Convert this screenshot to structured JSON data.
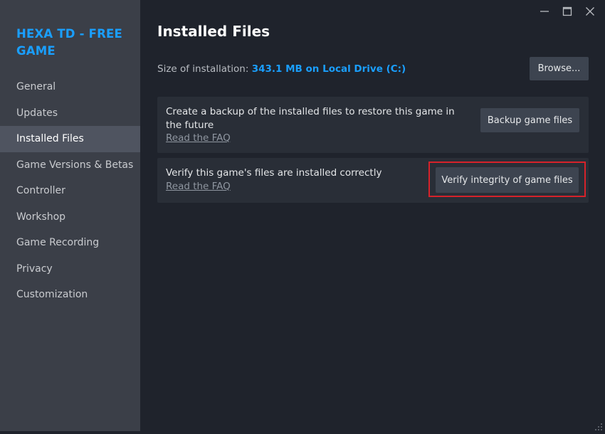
{
  "sidebar": {
    "game_title": "HEXA TD - FREE GAME",
    "items": [
      {
        "label": "General",
        "active": false
      },
      {
        "label": "Updates",
        "active": false
      },
      {
        "label": "Installed Files",
        "active": true
      },
      {
        "label": "Game Versions & Betas",
        "active": false
      },
      {
        "label": "Controller",
        "active": false
      },
      {
        "label": "Workshop",
        "active": false
      },
      {
        "label": "Game Recording",
        "active": false
      },
      {
        "label": "Privacy",
        "active": false
      },
      {
        "label": "Customization",
        "active": false
      }
    ]
  },
  "window_controls": {
    "minimize_icon": "minimize-icon",
    "maximize_icon": "maximize-icon",
    "close_icon": "close-icon"
  },
  "main": {
    "title": "Installed Files",
    "size_label": "Size of installation:",
    "size_value": "343.1 MB on Local Drive (C:)",
    "browse_label": "Browse...",
    "backup_card": {
      "text": "Create a backup of the installed files to restore this game in the future",
      "link": "Read the FAQ",
      "button": "Backup game files"
    },
    "verify_card": {
      "text": "Verify this game's files are installed correctly",
      "link": "Read the FAQ",
      "button": "Verify integrity of game files"
    }
  },
  "colors": {
    "accent": "#1a9fff",
    "highlight": "#d6222a",
    "sidebar_bg": "#3b3f48",
    "main_bg": "#1f232c"
  }
}
